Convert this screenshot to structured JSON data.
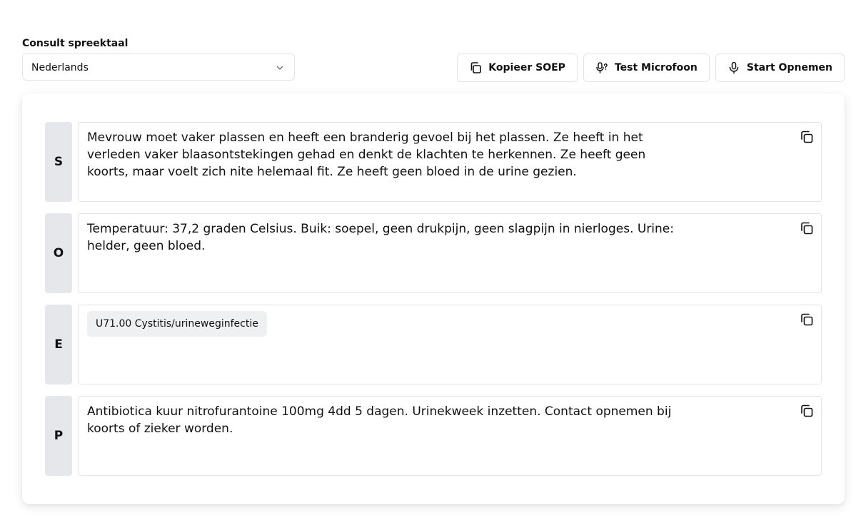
{
  "language": {
    "label": "Consult spreektaal",
    "selected": "Nederlands"
  },
  "actions": {
    "copy_soep": "Kopieer SOEP",
    "test_mic": "Test Microfoon",
    "start_recording": "Start Opnemen"
  },
  "soep": {
    "s": {
      "letter": "S",
      "text": "Mevrouw moet vaker plassen en heeft een branderig gevoel bij het plassen. Ze heeft in het verleden vaker blaasontstekingen gehad en denkt de klachten te herkennen. Ze heeft geen koorts, maar voelt zich nite helemaal fit. Ze heeft geen bloed in de urine gezien."
    },
    "o": {
      "letter": "O",
      "text": "Temperatuur: 37,2 graden Celsius. Buik: soepel, geen drukpijn, geen slagpijn in nierloges. Urine: helder, geen bloed."
    },
    "e": {
      "letter": "E",
      "chip": "U71.00 Cystitis/urineweginfectie"
    },
    "p": {
      "letter": "P",
      "text": "Antibiotica kuur nitrofurantoine 100mg 4dd 5 dagen. Urinekweek inzetten. Contact opnemen bij koorts of zieker worden."
    }
  }
}
